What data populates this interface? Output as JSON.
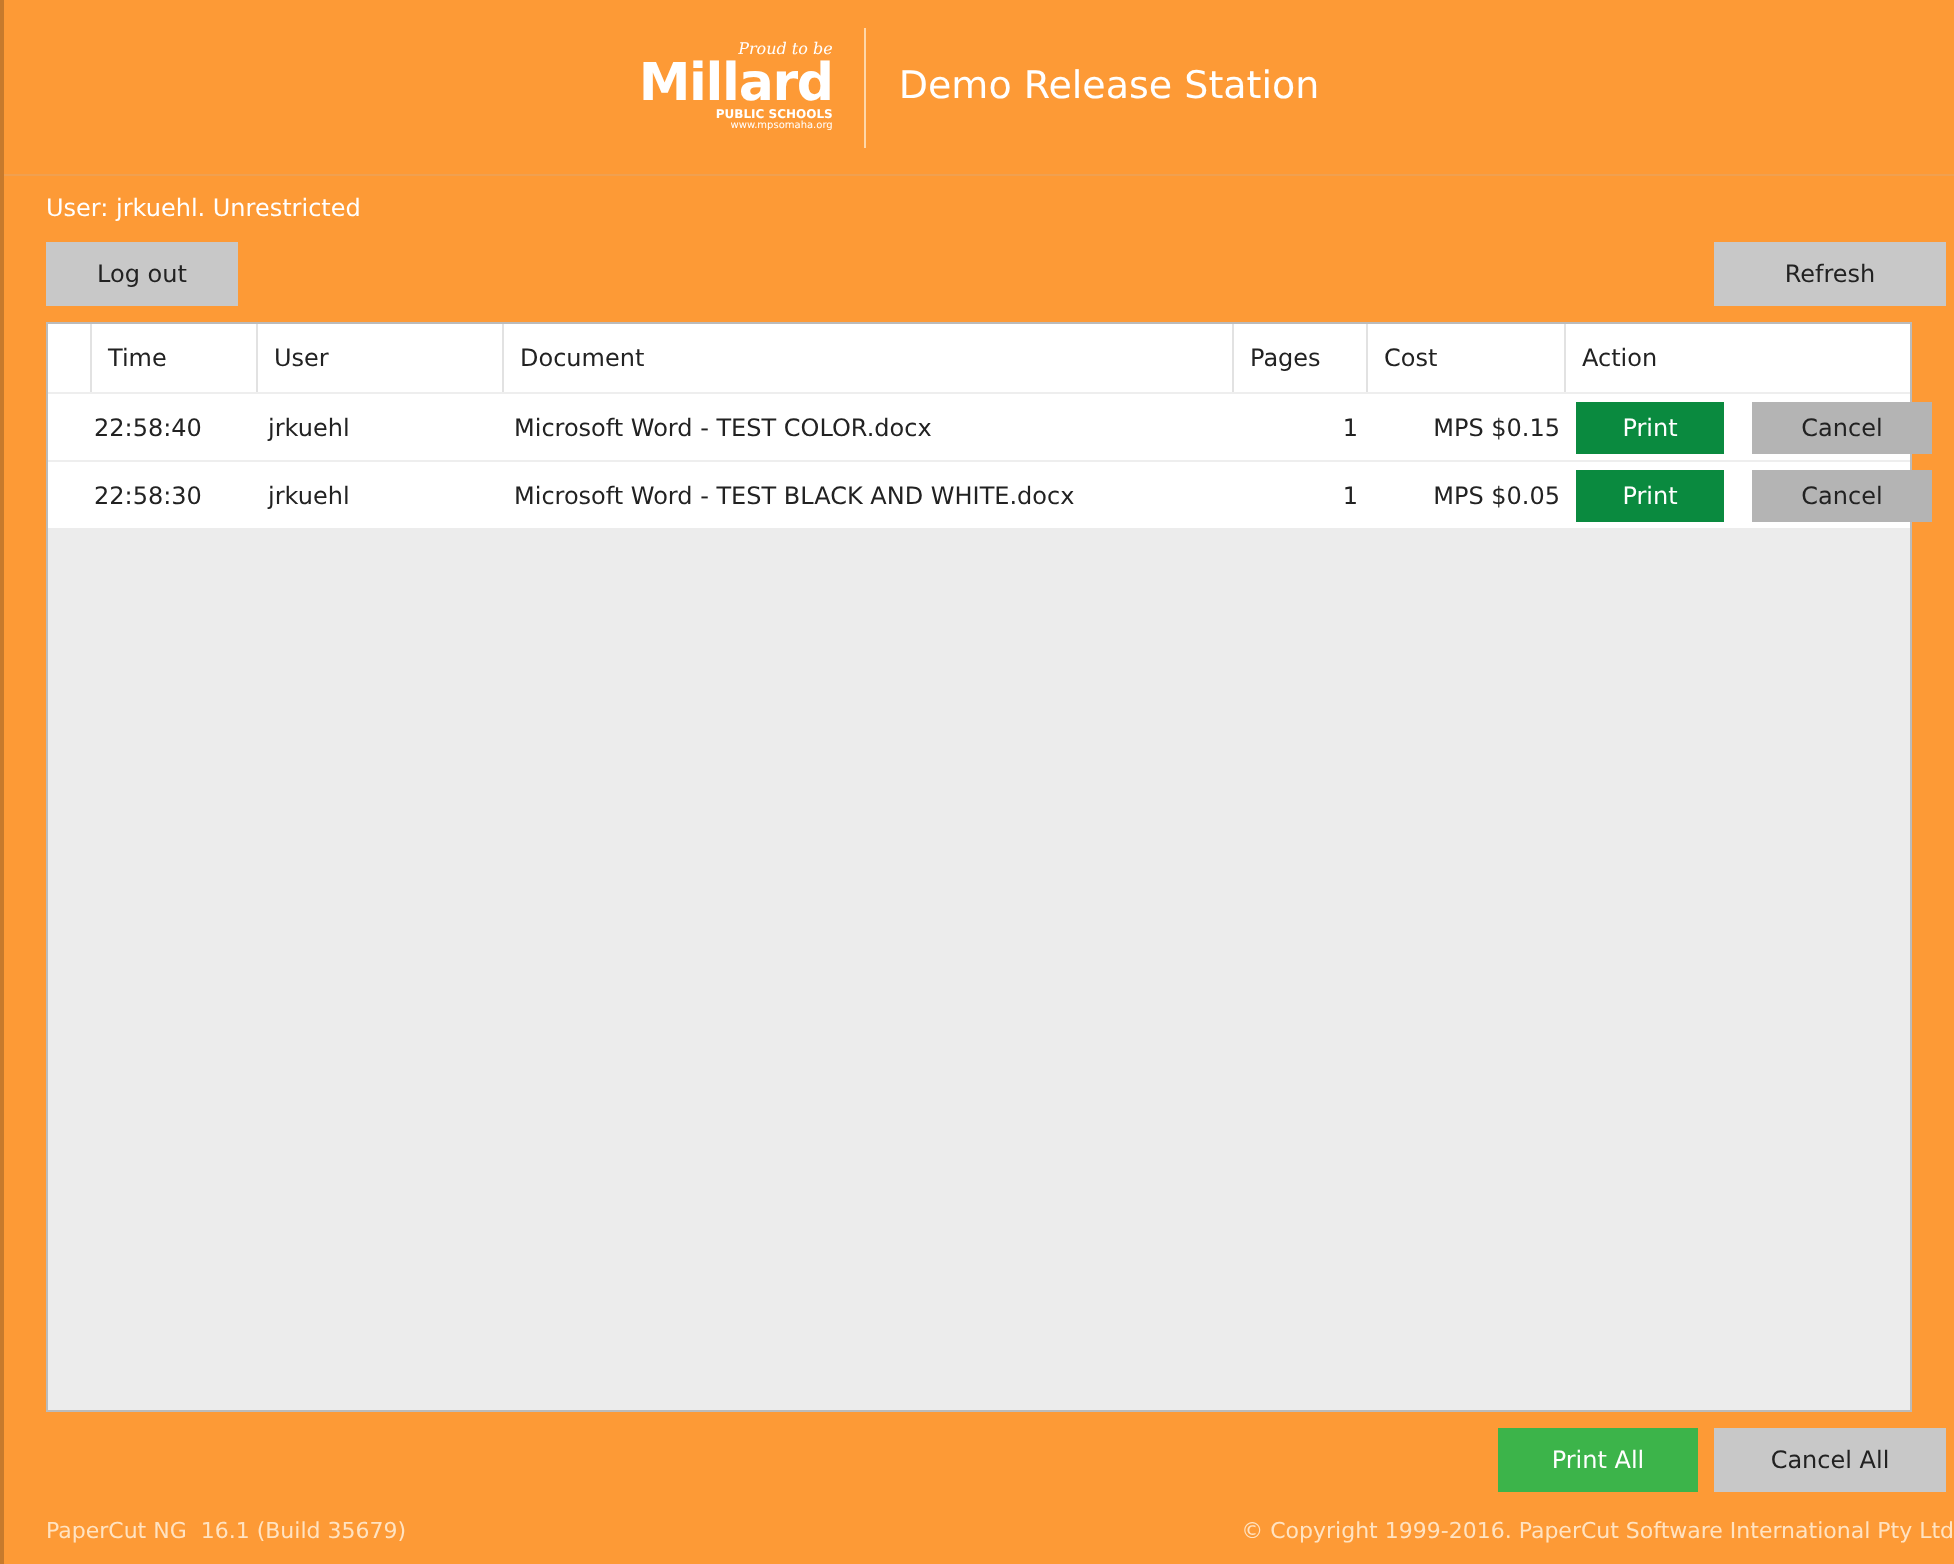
{
  "logo": {
    "tagline": "Proud to be",
    "name": "Millard",
    "subtitle": "PUBLIC SCHOOLS",
    "url": "www.mpsomaha.org"
  },
  "title": "Demo Release Station",
  "user_status": "User: jrkuehl. Unrestricted",
  "buttons": {
    "logout": "Log out",
    "refresh": "Refresh",
    "print_all": "Print All",
    "cancel_all": "Cancel All"
  },
  "table": {
    "columns": [
      "Time",
      "User",
      "Document",
      "Pages",
      "Cost",
      "Action"
    ],
    "rows": [
      {
        "time": "22:58:40",
        "user": "jrkuehl",
        "document": "Microsoft Word - TEST COLOR.docx",
        "pages": "1",
        "cost": "MPS $0.15",
        "print": "Print",
        "cancel": "Cancel"
      },
      {
        "time": "22:58:30",
        "user": "jrkuehl",
        "document": "Microsoft Word - TEST BLACK AND WHITE.docx",
        "pages": "1",
        "cost": "MPS $0.05",
        "print": "Print",
        "cancel": "Cancel"
      }
    ]
  },
  "status_bar": {
    "version": "PaperCut NG  16.1 (Build 35679)",
    "copyright": "© Copyright 1999-2016. PaperCut Software International Pty Ltd"
  }
}
